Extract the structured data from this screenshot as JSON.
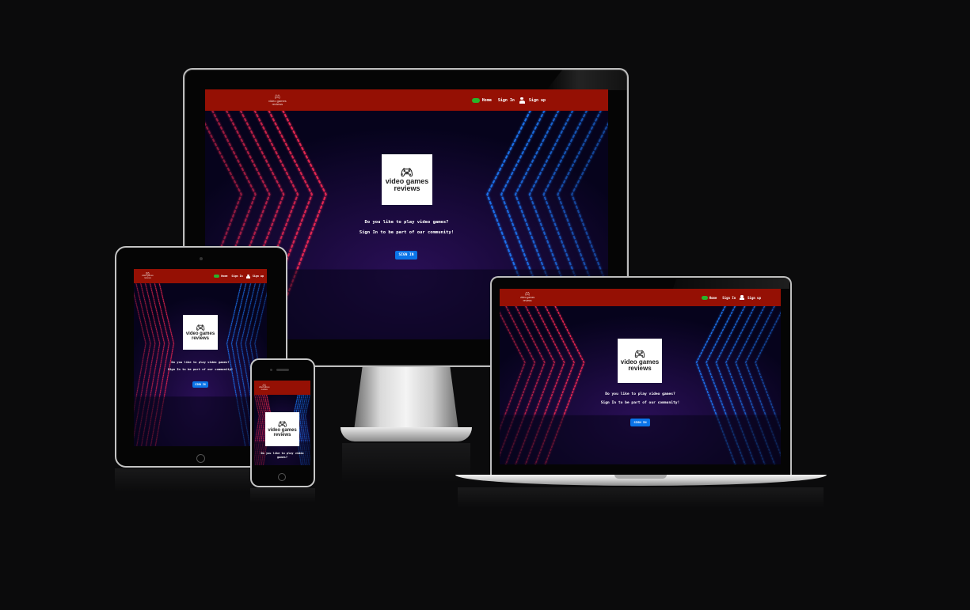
{
  "site": {
    "logo_line1": "video games",
    "logo_line2": "reviews",
    "nav": {
      "home": "Home",
      "signin": "Sign In",
      "signup": "Sign up"
    },
    "hero": {
      "line1": "Do you like to play video games?",
      "line2": "Sign In to be part of our community!",
      "button": "SIGN IN"
    }
  },
  "colors": {
    "navbar": "#951004",
    "home_icon": "#29b52a",
    "button": "#0b74e8",
    "neon_red": "#ff2a55",
    "neon_blue": "#1f7bff"
  },
  "icons": {
    "logo": "gamepad-icon",
    "home": "gamepad-icon",
    "signup": "user-plus-icon"
  }
}
